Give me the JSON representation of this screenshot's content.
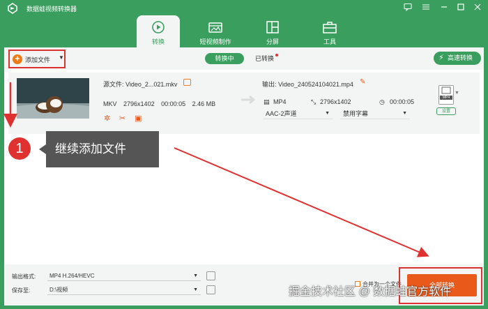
{
  "window": {
    "title": "数据蛙视频转换器",
    "accent": "#3a9e5e",
    "controls": [
      "chat-icon",
      "menu-icon",
      "minimize-icon",
      "maximize-icon",
      "close-icon"
    ]
  },
  "nav": {
    "tabs": [
      {
        "label": "转换",
        "icon": "convert-icon",
        "active": true
      },
      {
        "label": "短视频制作",
        "icon": "short-video-icon",
        "active": false
      },
      {
        "label": "分屏",
        "icon": "split-screen-icon",
        "active": false
      },
      {
        "label": "工具",
        "icon": "toolbox-icon",
        "active": false
      }
    ]
  },
  "toolbar": {
    "add_file": "添加文件",
    "converting": "转换中",
    "converted": "已转换",
    "high_speed": "高速转换"
  },
  "file": {
    "source_label": "源文件:  Video_2...021.mkv",
    "source_format": "MKV",
    "source_resolution": "2796x1402",
    "source_duration": "00:00:05",
    "source_size": "2.46 MB",
    "output_label": "输出:  Video_240524104021.mp4",
    "output_format": "MP4",
    "output_resolution": "2796x1402",
    "output_duration": "00:00:05",
    "audio": "AAC-2声道",
    "subtitle": "禁用字幕",
    "format_badge": "MP4",
    "settings": "设置"
  },
  "instruction": {
    "number": "1",
    "text": "继续添加文件",
    "color": "#e03131"
  },
  "bottom": {
    "output_format_label": "输出格式:",
    "output_format_value": "MP4 H.264/HEVC",
    "save_to_label": "保存至:",
    "save_to_value": "D:\\视频",
    "merge_label": "合并为一个文件",
    "convert_all": "全部转换"
  },
  "watermark": "掘金技术社区 @ 数据蛙官方软件"
}
